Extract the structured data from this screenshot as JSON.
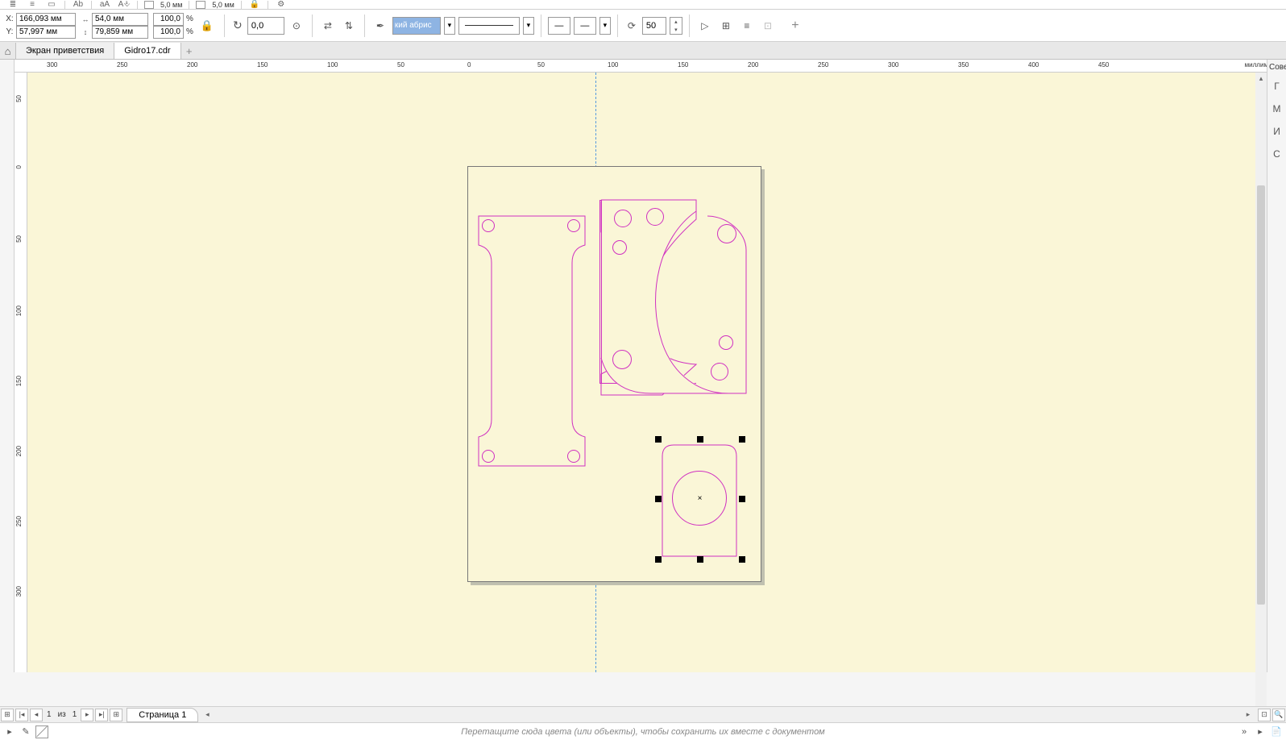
{
  "toolbar1": {
    "spacing1": "5,0 мм",
    "spacing2": "5,0 мм"
  },
  "toolbar2": {
    "x_label": "X:",
    "y_label": "Y:",
    "x": "166,093 мм",
    "y": "57,997 мм",
    "w": "54,0 мм",
    "h": "79,859 мм",
    "scale_x": "100,0",
    "scale_y": "100,0",
    "pct": "%",
    "rotation": "0,0",
    "outline_width": "кий абрис",
    "wrap_offset": "50"
  },
  "tabs": {
    "welcome": "Экран приветствия",
    "file": "Gidro17.cdr"
  },
  "ruler": {
    "unit": "миллиметры",
    "h_ticks": [
      "300",
      "250",
      "200",
      "150",
      "100",
      "50",
      "0",
      "50",
      "100",
      "150",
      "200",
      "250",
      "300",
      "350",
      "400",
      "450"
    ],
    "v_ticks": [
      "50",
      "0",
      "50",
      "100",
      "150",
      "200",
      "250",
      "300"
    ]
  },
  "right_panel": {
    "hints": "Совет",
    "items": [
      "Г",
      "М",
      "И",
      "С"
    ]
  },
  "page_nav": {
    "current": "1",
    "of_label": "из",
    "total": "1",
    "page_label": "Страница 1"
  },
  "palette": {
    "hint": "Перетащите сюда цвета (или объекты), чтобы сохранить их вместе с документом"
  }
}
